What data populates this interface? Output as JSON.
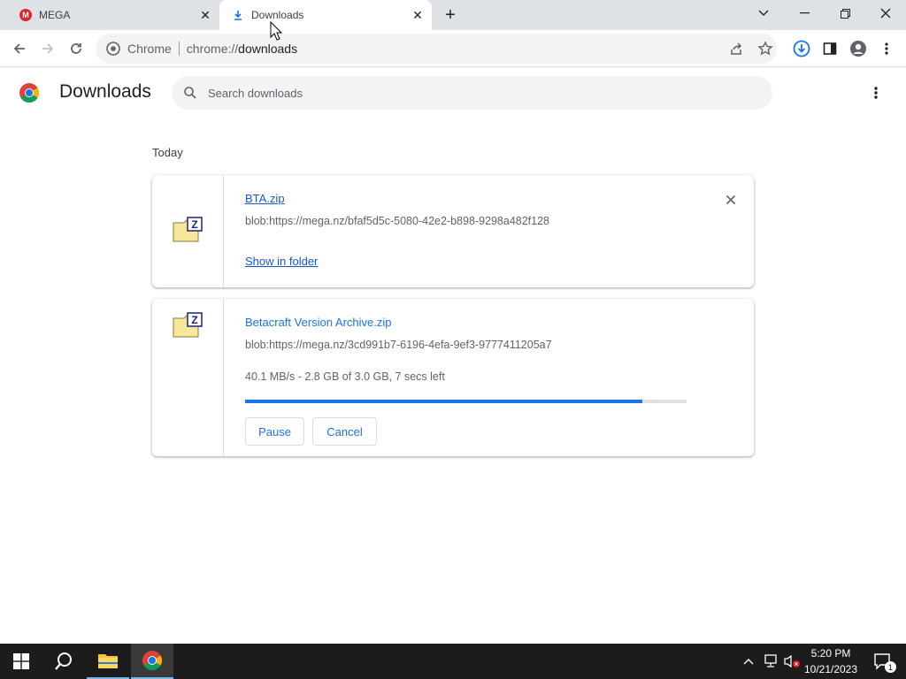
{
  "tabs": [
    {
      "title": "MEGA",
      "active": false
    },
    {
      "title": "Downloads",
      "active": true
    }
  ],
  "omnibox": {
    "scheme_label": "Chrome",
    "url_prefix": "chrome://",
    "url_host": "downloads"
  },
  "page": {
    "title": "Downloads",
    "search_placeholder": "Search downloads",
    "section": "Today"
  },
  "downloads": [
    {
      "filename": "BTA.zip",
      "url": "blob:https://mega.nz/bfaf5d5c-5080-42e2-b898-9298a482f128",
      "action_link": "Show in folder",
      "state": "complete"
    },
    {
      "filename": "Betacraft Version Archive.zip",
      "url": "blob:https://mega.nz/3cd991b7-6196-4efa-9ef3-9777411205a7",
      "status": "40.1 MB/s - 2.8 GB of 3.0 GB, 7 secs left",
      "progress_fraction": 0.9,
      "pause_label": "Pause",
      "cancel_label": "Cancel",
      "state": "in_progress"
    }
  ],
  "taskbar": {
    "time": "5:20 PM",
    "date": "10/21/2023",
    "notification_count": "1"
  },
  "colors": {
    "accent": "#1a73e8",
    "tabstrip": "#dee1e6",
    "taskbar": "#1c1c1c",
    "mega_red": "#d9272e"
  },
  "icons": [
    "mega-logo-icon",
    "download-icon",
    "close-icon",
    "new-tab-icon",
    "tab-search-icon",
    "minimize-icon",
    "restore-icon",
    "back-icon",
    "forward-icon",
    "reload-icon",
    "chrome-icon",
    "share-icon",
    "star-icon",
    "downloads-toolbar-icon",
    "side-panel-icon",
    "profile-icon",
    "menu-icon",
    "search-icon",
    "zip-file-icon",
    "windows-start-icon",
    "taskbar-search-icon",
    "file-explorer-icon",
    "chrome-taskbar-icon",
    "chevron-up-icon",
    "network-icon",
    "volume-muted-icon",
    "notification-icon"
  ]
}
